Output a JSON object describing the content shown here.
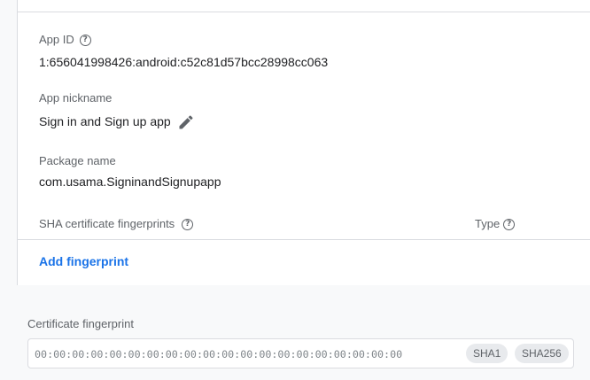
{
  "app_id": {
    "label": "App ID",
    "value": "1:656041998426:android:c52c81d57bcc28998cc063"
  },
  "app_nickname": {
    "label": "App nickname",
    "value": "Sign in and Sign up app"
  },
  "package_name": {
    "label": "Package name",
    "value": "com.usama.SigninandSignupapp"
  },
  "sha_section": {
    "label": "SHA certificate fingerprints",
    "type_label": "Type",
    "add_link": "Add fingerprint"
  },
  "certificate": {
    "label": "Certificate fingerprint",
    "placeholder": "00:00:00:00:00:00:00:00:00:00:00:00:00:00:00:00:00:00:00:00",
    "options": [
      "SHA1",
      "SHA256"
    ]
  },
  "icons": {
    "help": "help-circle-icon",
    "edit": "pencil-icon"
  },
  "colors": {
    "link": "#1a73e8",
    "text": "#202124",
    "label": "#5f6368"
  }
}
